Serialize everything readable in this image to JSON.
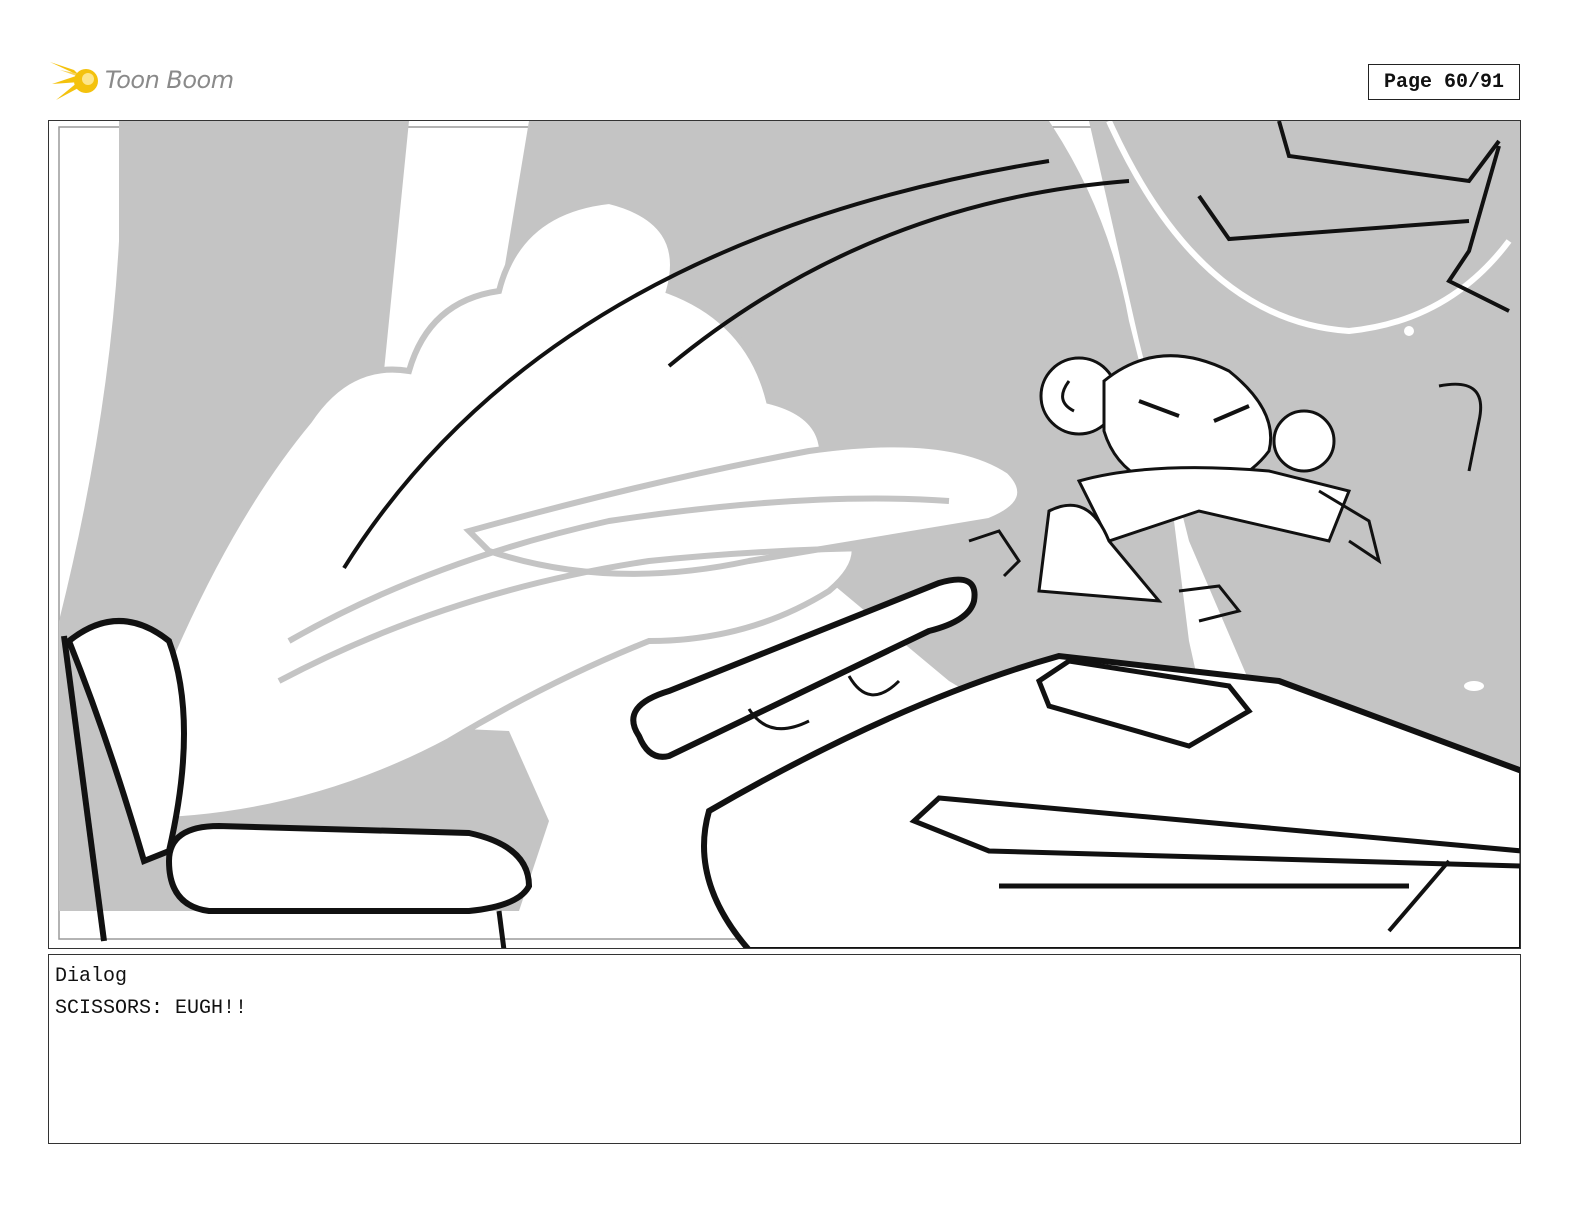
{
  "header": {
    "logo_text": "Toon Boom",
    "page_label": "Page 60/91"
  },
  "panel": {
    "dialog_heading": "Dialog",
    "dialog_line": "SCISSORS: EUGH!!"
  },
  "colors": {
    "logo_flame": "#f4c20d",
    "sketch_gray": "#c4c4c4",
    "ink": "#111111"
  }
}
